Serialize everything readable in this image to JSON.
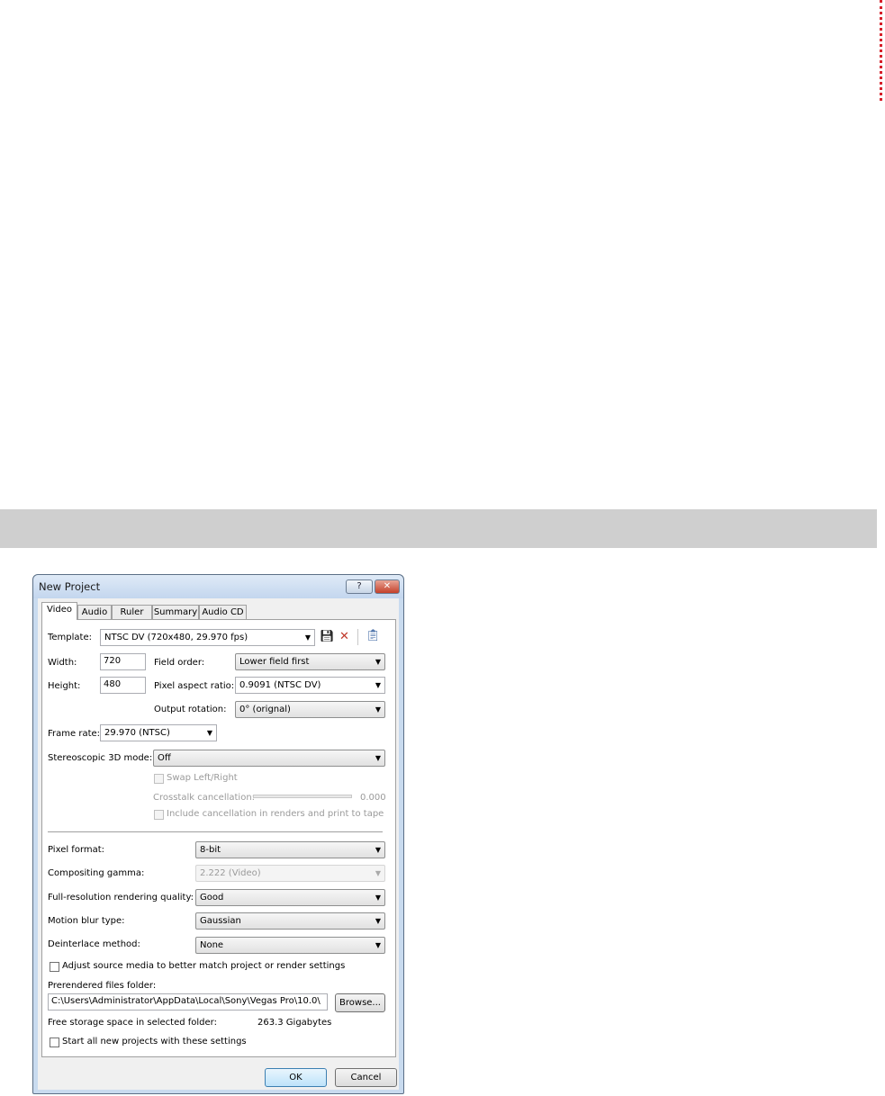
{
  "dialog": {
    "title": "New Project",
    "help_label": "?",
    "close_label": "✕"
  },
  "tabs": [
    "Video",
    "Audio",
    "Ruler",
    "Summary",
    "Audio CD"
  ],
  "video": {
    "template_label": "Template:",
    "template_value": "NTSC DV (720x480, 29.970 fps)",
    "width_label": "Width:",
    "width_value": "720",
    "height_label": "Height:",
    "height_value": "480",
    "field_order_label": "Field order:",
    "field_order_value": "Lower field first",
    "pixel_aspect_label": "Pixel aspect ratio:",
    "pixel_aspect_value": "0.9091 (NTSC DV)",
    "output_rotation_label": "Output rotation:",
    "output_rotation_value": "0° (orignal)",
    "frame_rate_label": "Frame rate:",
    "frame_rate_value": "29.970 (NTSC)",
    "stereo_label": "Stereoscopic 3D mode:",
    "stereo_value": "Off",
    "swap_label": "Swap Left/Right",
    "crosstalk_label": "Crosstalk cancellation:",
    "crosstalk_value": "0.000",
    "include_cancel_label": "Include cancellation in renders and print to tape",
    "pixel_format_label": "Pixel format:",
    "pixel_format_value": "8-bit",
    "gamma_label": "Compositing gamma:",
    "gamma_value": "2.222 (Video)",
    "quality_label": "Full-resolution rendering quality:",
    "quality_value": "Good",
    "motion_blur_label": "Motion blur type:",
    "motion_blur_value": "Gaussian",
    "deinterlace_label": "Deinterlace method:",
    "deinterlace_value": "None",
    "adjust_label": "Adjust source media to better match project or render settings",
    "prerender_label": "Prerendered files folder:",
    "prerender_value": "C:\\Users\\Administrator\\AppData\\Local\\Sony\\Vegas Pro\\10.0\\",
    "browse_label": "Browse...",
    "free_label": "Free storage space in selected folder:",
    "free_value": "263.3 Gigabytes",
    "start_label": "Start all new projects with these settings"
  },
  "buttons": {
    "ok": "OK",
    "cancel": "Cancel"
  },
  "icons": {
    "save": "floppy-disk",
    "delete": "red-x",
    "copy": "clipboard",
    "dropdown": "triangle-down"
  },
  "colors": {
    "accent_delete": "#c0392b",
    "divider_dots": "#d6202a",
    "band": "#cfcfcf"
  }
}
